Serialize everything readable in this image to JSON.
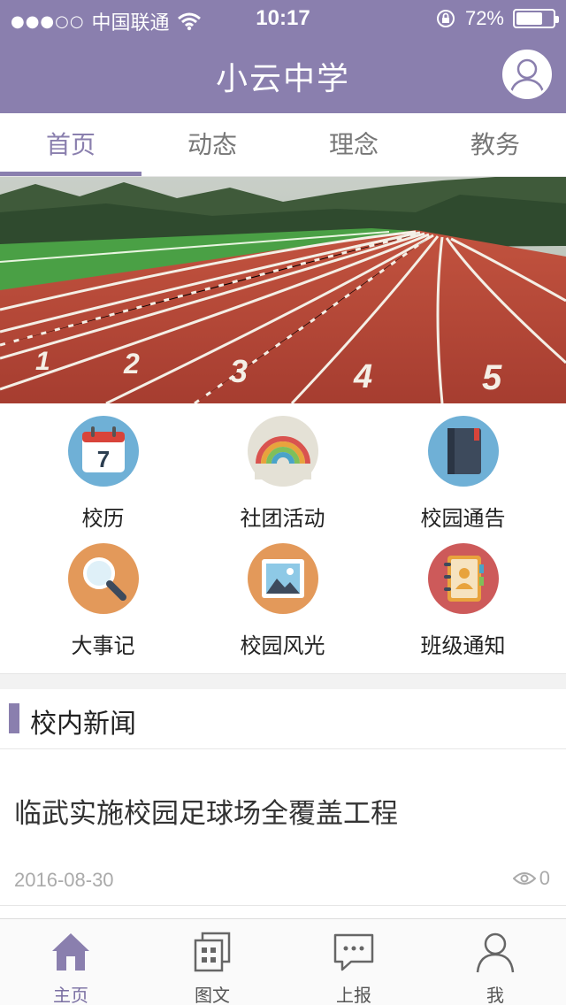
{
  "status_bar": {
    "signal_dots": "●●●○○",
    "carrier": "中国联通",
    "time": "10:17",
    "battery_percent": "72%",
    "battery_level": 0.72
  },
  "header": {
    "title": "小云中学",
    "avatar_icon": "user-avatar-icon"
  },
  "tabs": [
    {
      "label": "首页",
      "active": true
    },
    {
      "label": "动态",
      "active": false
    },
    {
      "label": "理念",
      "active": false
    },
    {
      "label": "教务",
      "active": false
    }
  ],
  "banner": {
    "lane_numbers": [
      "1",
      "2",
      "3",
      "4",
      "5"
    ]
  },
  "quick_links": [
    {
      "label": "校历",
      "icon": "calendar-icon",
      "icon_text": "7",
      "color": "#6fb0d6"
    },
    {
      "label": "社团活动",
      "icon": "rainbow-icon",
      "color": "#e4e1d6"
    },
    {
      "label": "校园通告",
      "icon": "notebook-icon",
      "color": "#6fb0d6"
    },
    {
      "label": "大事记",
      "icon": "magnifier-icon",
      "color": "#e3995a"
    },
    {
      "label": "校园风光",
      "icon": "picture-icon",
      "color": "#e3995a"
    },
    {
      "label": "班级通知",
      "icon": "contacts-book-icon",
      "color": "#cd5a5a"
    }
  ],
  "news": {
    "section_title": "校内新闻",
    "items": [
      {
        "headline": "临武实施校园足球场全覆盖工程",
        "date": "2016-08-30",
        "views": "0"
      }
    ]
  },
  "bottom_nav": [
    {
      "label": "主页",
      "icon": "home-icon",
      "active": true
    },
    {
      "label": "图文",
      "icon": "gallery-icon",
      "active": false
    },
    {
      "label": "上报",
      "icon": "chat-icon",
      "active": false
    },
    {
      "label": "我",
      "icon": "person-icon",
      "active": false
    }
  ],
  "colors": {
    "primary": "#8a7fae",
    "tab_active": "#8a7fae",
    "track_red": "#b9473a",
    "grass_green": "#4aa045"
  }
}
